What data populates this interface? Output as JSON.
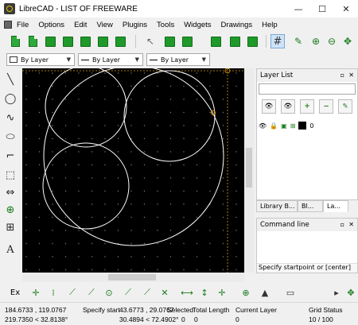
{
  "window": {
    "title": "LibreCAD - LIST OF FREEWARE",
    "minimize_glyph": "—",
    "maximize_glyph": "☐",
    "close_glyph": "✕"
  },
  "menu": {
    "items": [
      "File",
      "Options",
      "Edit",
      "View",
      "Plugins",
      "Tools",
      "Widgets",
      "Drawings",
      "Help"
    ]
  },
  "pen_toolbar": {
    "color": "By Layer",
    "width": "By Layer",
    "linetype": "By Layer"
  },
  "layer_list": {
    "title": "Layer List",
    "filter_placeholder": "",
    "layers": [
      {
        "name": "0"
      }
    ]
  },
  "dock_tabs": [
    "Library B...",
    "Bl...",
    "La..."
  ],
  "command_line": {
    "title": "Command line",
    "prompt": "Specify startpoint or [center]"
  },
  "bottom_toolbar": {
    "ex_label": "Ex"
  },
  "status": {
    "abs_coord": "184.6733 , 119.0767",
    "abs_polar": "219.7350 < 32.8138°",
    "rel_coord": "43.6773 , 29.0767",
    "rel_polar": "30.4894 < 72.4902°",
    "prompt_overlap": "Specify start",
    "selected_label": "Selected",
    "selected_value": "0",
    "total_length_label": "Total Length",
    "total_length_value": "0",
    "current_layer_label": "Current Layer",
    "current_layer_value": "0",
    "grid_label": "Grid Status",
    "grid_value": "10 / 100"
  },
  "colors": {
    "canvas_bg": "#000000",
    "grid_dot": "#7a7a7a",
    "entity": "#ffffff",
    "relative_zero": "#e8a000",
    "toolbar_green": "#1f9a2a"
  }
}
